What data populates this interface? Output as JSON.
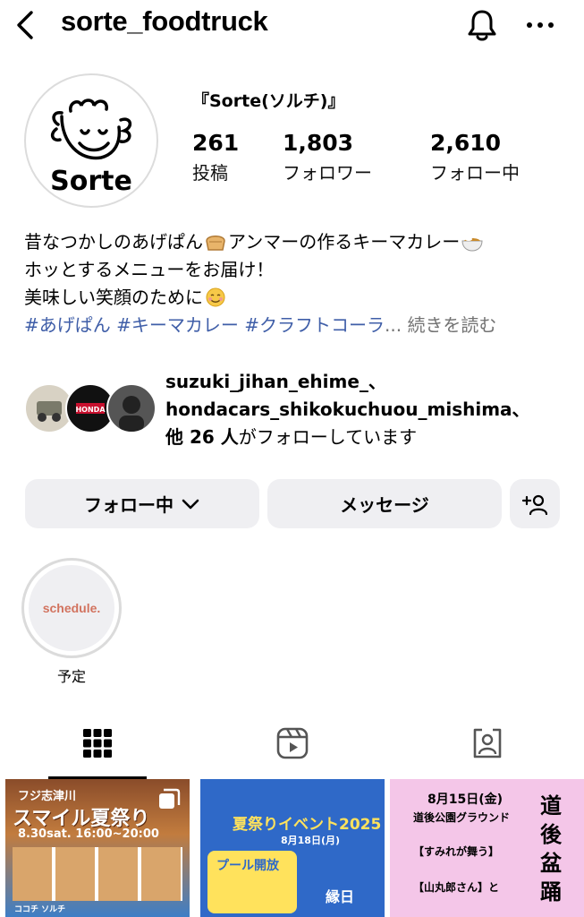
{
  "header": {
    "username": "sorte_foodtruck"
  },
  "profile": {
    "avatar_text": "Sorte",
    "display_name": "『Sorte(ソルチ)』",
    "posts_count": "261",
    "posts_label": "投稿",
    "followers_count": "1,803",
    "followers_label": "フォロワー",
    "following_count": "2,610",
    "following_label": "フォロー中"
  },
  "bio": {
    "line1_a": "昔なつかしのあげぱん",
    "line1_b": "アンマーの作るキーマカレー",
    "line2": "ホッとするメニューをお届け！",
    "line3": "美味しい笑顔のために",
    "hashtags": "#あげぱん #キーマカレー #クラフトコーラ",
    "ellipsis": "...",
    "more": "続きを読む"
  },
  "mutual": {
    "user1": "suzuki_jihan_ehime_、",
    "user2": "hondacars_shikokuchuou_mishima、",
    "others_count": "他 26 人",
    "suffix": "がフォローしています",
    "avatar2_text": "HONDA"
  },
  "actions": {
    "following_label": "フォロー中",
    "message_label": "メッセージ"
  },
  "highlights": [
    {
      "cover_text": "schedule.",
      "label": "予定"
    }
  ],
  "posts": [
    {
      "line1": "フジ志津川",
      "line2": "スマイル夏祭り",
      "line3": "8.30sat.  16:00~20:00",
      "foot": "ココチ    ソルチ"
    },
    {
      "line1": "夏祭りイベント2025",
      "line2": "8月18日(月)",
      "line3": "プール開放",
      "foot": "縁日"
    },
    {
      "line1": "8月15日(金)",
      "line2": "道後公園グラウンド",
      "line3": "【すみれが舞う】",
      "foot": "【山丸郎さん】と",
      "side": "道後盆踊"
    }
  ],
  "colors": {
    "hashtag": "#3f5ea8",
    "button_bg": "#efeff2",
    "muted": "#737373",
    "highlight_text": "#d2735f"
  }
}
